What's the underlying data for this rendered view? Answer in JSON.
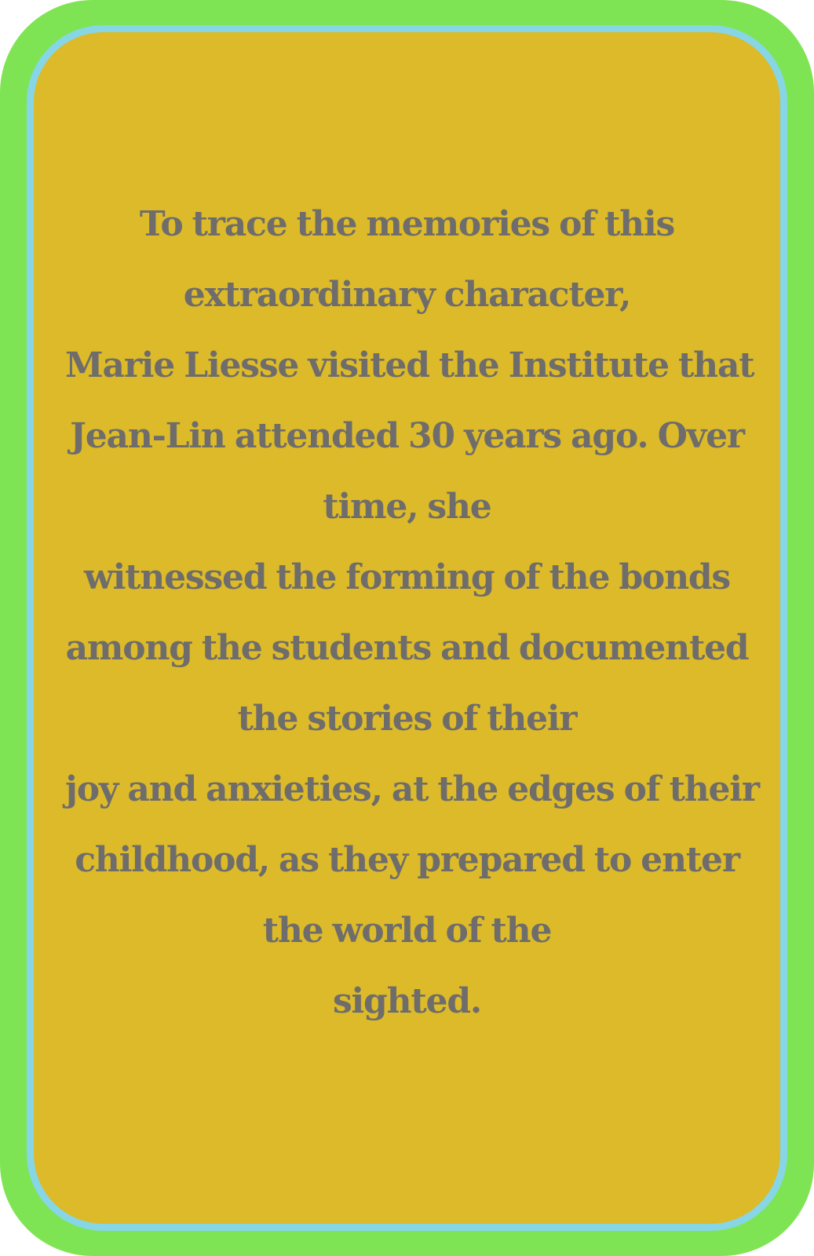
{
  "card": {
    "lines": [
      "To trace the memories of this",
      "extraordinary character,",
      "Marie Liesse visited the Institute that",
      "Jean-Lin attended 30 years ago. Over",
      "time, she",
      "witnessed the forming of the bonds",
      "among the students and documented",
      "the stories of their",
      "joy and anxieties, at the edges of their",
      "childhood, as they prepared to enter",
      "the world of the",
      "sighted."
    ]
  },
  "colors": {
    "outer_frame": "#7fe454",
    "inner_border": "#86d6e6",
    "card_background": "#dcba29",
    "text": "#6f6d6b"
  }
}
